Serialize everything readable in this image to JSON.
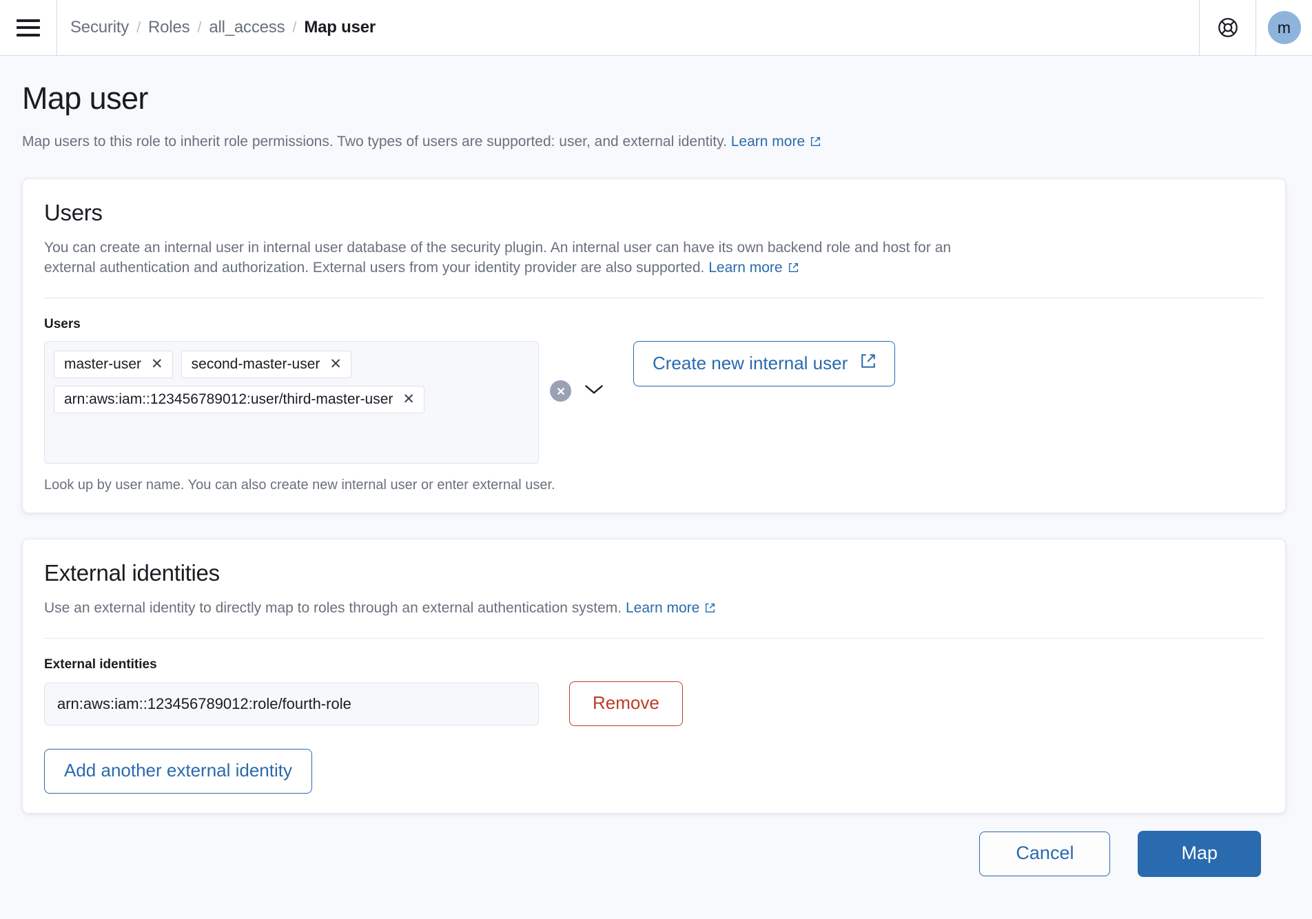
{
  "header": {
    "menu_icon": "hamburger-menu-icon",
    "help_icon": "lifebuoy-help-icon",
    "avatar_initial": "m",
    "avatar_color": "#8fb4dc",
    "breadcrumb": [
      {
        "label": "Security",
        "current": false
      },
      {
        "label": "Roles",
        "current": false
      },
      {
        "label": "all_access",
        "current": false
      },
      {
        "label": "Map user",
        "current": true
      }
    ],
    "separator": "/"
  },
  "page": {
    "title": "Map user",
    "description": "Map users to this role to inherit role permissions. Two types of users are supported: user, and external identity.",
    "learn_more": "Learn more"
  },
  "users_panel": {
    "title": "Users",
    "description": "You can create an internal user in internal user database of the security plugin. An internal user can have its own backend role and host for an external authentication and authorization. External users from your identity provider are also supported.",
    "learn_more": "Learn more",
    "field_label": "Users",
    "pills": [
      "master-user",
      "second-master-user",
      "arn:aws:iam::123456789012:user/third-master-user"
    ],
    "pill_remove_glyph": "✕",
    "clear_all_icon": "clear-all-circle-icon",
    "dropdown_icon": "chevron-down-icon",
    "create_button": "Create new internal user",
    "hint": "Look up by user name. You can also create new internal user or enter external user."
  },
  "external_panel": {
    "title": "External identities",
    "description": "Use an external identity to directly map to roles through an external authentication system.",
    "learn_more": "Learn more",
    "field_label": "External identities",
    "identity_value": "arn:aws:iam::123456789012:role/fourth-role",
    "identity_placeholder": "",
    "remove_button": "Remove",
    "add_button": "Add another external identity"
  },
  "footer": {
    "cancel": "Cancel",
    "submit": "Map",
    "primary_color": "#2a6aae",
    "danger_color": "#bd3c26"
  }
}
